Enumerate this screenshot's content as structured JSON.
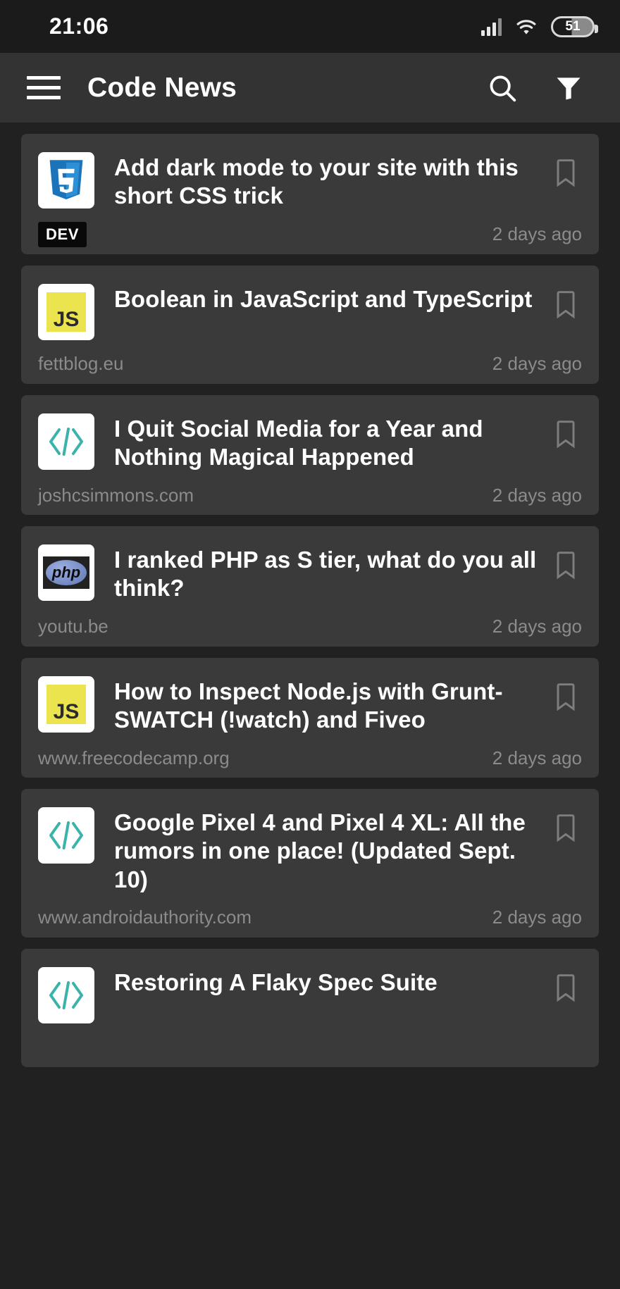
{
  "status_bar": {
    "time": "21:06",
    "battery_level": "51",
    "icons": [
      "signal-icon",
      "wifi-icon",
      "battery-icon"
    ]
  },
  "app_bar": {
    "title": "Code News",
    "menu_icon": "hamburger-menu-icon",
    "search_icon": "search-icon",
    "filter_icon": "filter-icon"
  },
  "colors": {
    "background": "#212121",
    "card": "#3a3a3a",
    "app_bar": "#333333",
    "status_bar": "#1b1b1b",
    "title_text": "#ffffff",
    "meta_text": "#8b8b8b",
    "code_icon": "#3bb3ab",
    "js_yellow": "#ece44f",
    "css_blue": "#1b73ba"
  },
  "articles": [
    {
      "title": "Add dark mode to your site with this short CSS trick",
      "logo": "css3-logo",
      "source": "",
      "badge": "DEV",
      "time": "2 days ago",
      "bookmark_icon": "bookmark-icon"
    },
    {
      "title": "Boolean in JavaScript and TypeScript",
      "logo": "javascript-logo",
      "source": "fettblog.eu",
      "badge": "",
      "time": "2 days ago",
      "bookmark_icon": "bookmark-icon"
    },
    {
      "title": "I Quit Social Media for a Year and Nothing Magical Happened",
      "logo": "code-brackets-logo",
      "source": "joshcsimmons.com",
      "badge": "",
      "time": "2 days ago",
      "bookmark_icon": "bookmark-icon"
    },
    {
      "title": "I ranked PHP as S tier, what do you all think?",
      "logo": "php-logo",
      "source": "youtu.be",
      "badge": "",
      "time": "2 days ago",
      "bookmark_icon": "bookmark-icon"
    },
    {
      "title": "How to Inspect Node.js with Grunt-SWATCH (!watch) and Fiveo",
      "logo": "javascript-logo",
      "source": "www.freecodecamp.org",
      "badge": "",
      "time": "2 days ago",
      "bookmark_icon": "bookmark-icon"
    },
    {
      "title": "Google Pixel 4 and Pixel 4 XL: All the rumors in one place! (Updated Sept. 10)",
      "logo": "code-brackets-logo",
      "source": "www.androidauthority.com",
      "badge": "",
      "time": "2 days ago",
      "bookmark_icon": "bookmark-icon"
    },
    {
      "title": "Restoring A Flaky Spec Suite",
      "logo": "code-brackets-logo",
      "source": "",
      "badge": "",
      "time": "",
      "bookmark_icon": "bookmark-icon"
    }
  ]
}
